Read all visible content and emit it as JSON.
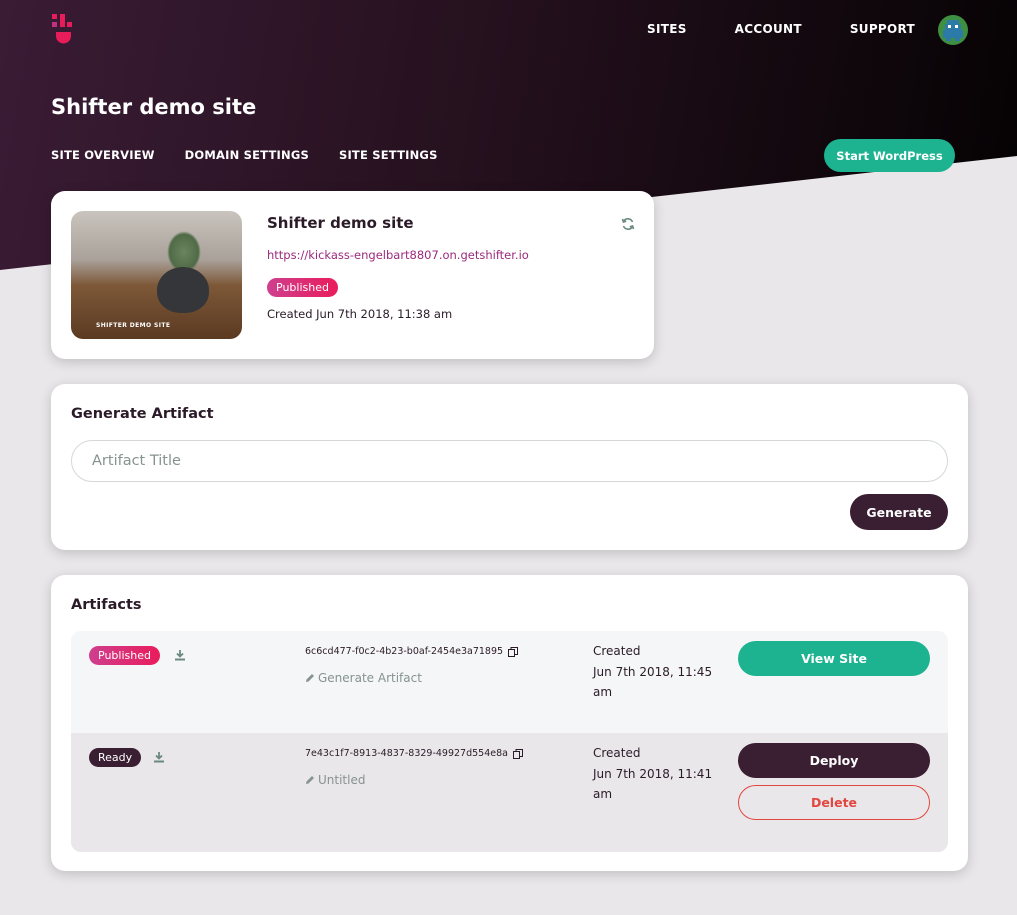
{
  "nav": {
    "sites": "SITES",
    "account": "ACCOUNT",
    "support": "SUPPORT"
  },
  "page": {
    "title": "Shifter demo site"
  },
  "subnav": {
    "overview": "SITE OVERVIEW",
    "domain": "DOMAIN SETTINGS",
    "settings": "SITE SETTINGS"
  },
  "start_button": "Start WordPress",
  "site": {
    "name": "Shifter demo site",
    "url": "https://kickass-engelbart8807.on.getshifter.io",
    "status": "Published",
    "created": "Created Jun 7th 2018, 11:38 am",
    "thumbnail_caption": "SHIFTER DEMO SITE"
  },
  "generate": {
    "title": "Generate Artifact",
    "placeholder": "Artifact Title",
    "button": "Generate"
  },
  "artifacts": {
    "title": "Artifacts",
    "rows": [
      {
        "status": "Published",
        "hash": "6c6cd477-f0c2-4b23-b0af-2454e3a71895",
        "name": "Generate Artifact",
        "created_label": "Created",
        "created_date": "Jun 7th 2018, 11:45",
        "created_time": "am",
        "action": "View Site"
      },
      {
        "status": "Ready",
        "hash": "7e43c1f7-8913-4837-8329-49927d554e8a",
        "name": "Untitled",
        "created_label": "Created",
        "created_date": "Jun 7th 2018, 11:41",
        "created_time": "am",
        "action": "Deploy",
        "secondary_action": "Delete"
      }
    ]
  },
  "colors": {
    "accent_green": "#1db391",
    "dark_plum": "#3a1e32",
    "published_pink": "#e91c5b",
    "delete_red": "#e3463f",
    "link_purple": "#9b2a7c"
  },
  "icons": [
    "logo-icon",
    "avatar",
    "refresh-icon",
    "download-icon",
    "copy-icon",
    "pencil-icon"
  ]
}
